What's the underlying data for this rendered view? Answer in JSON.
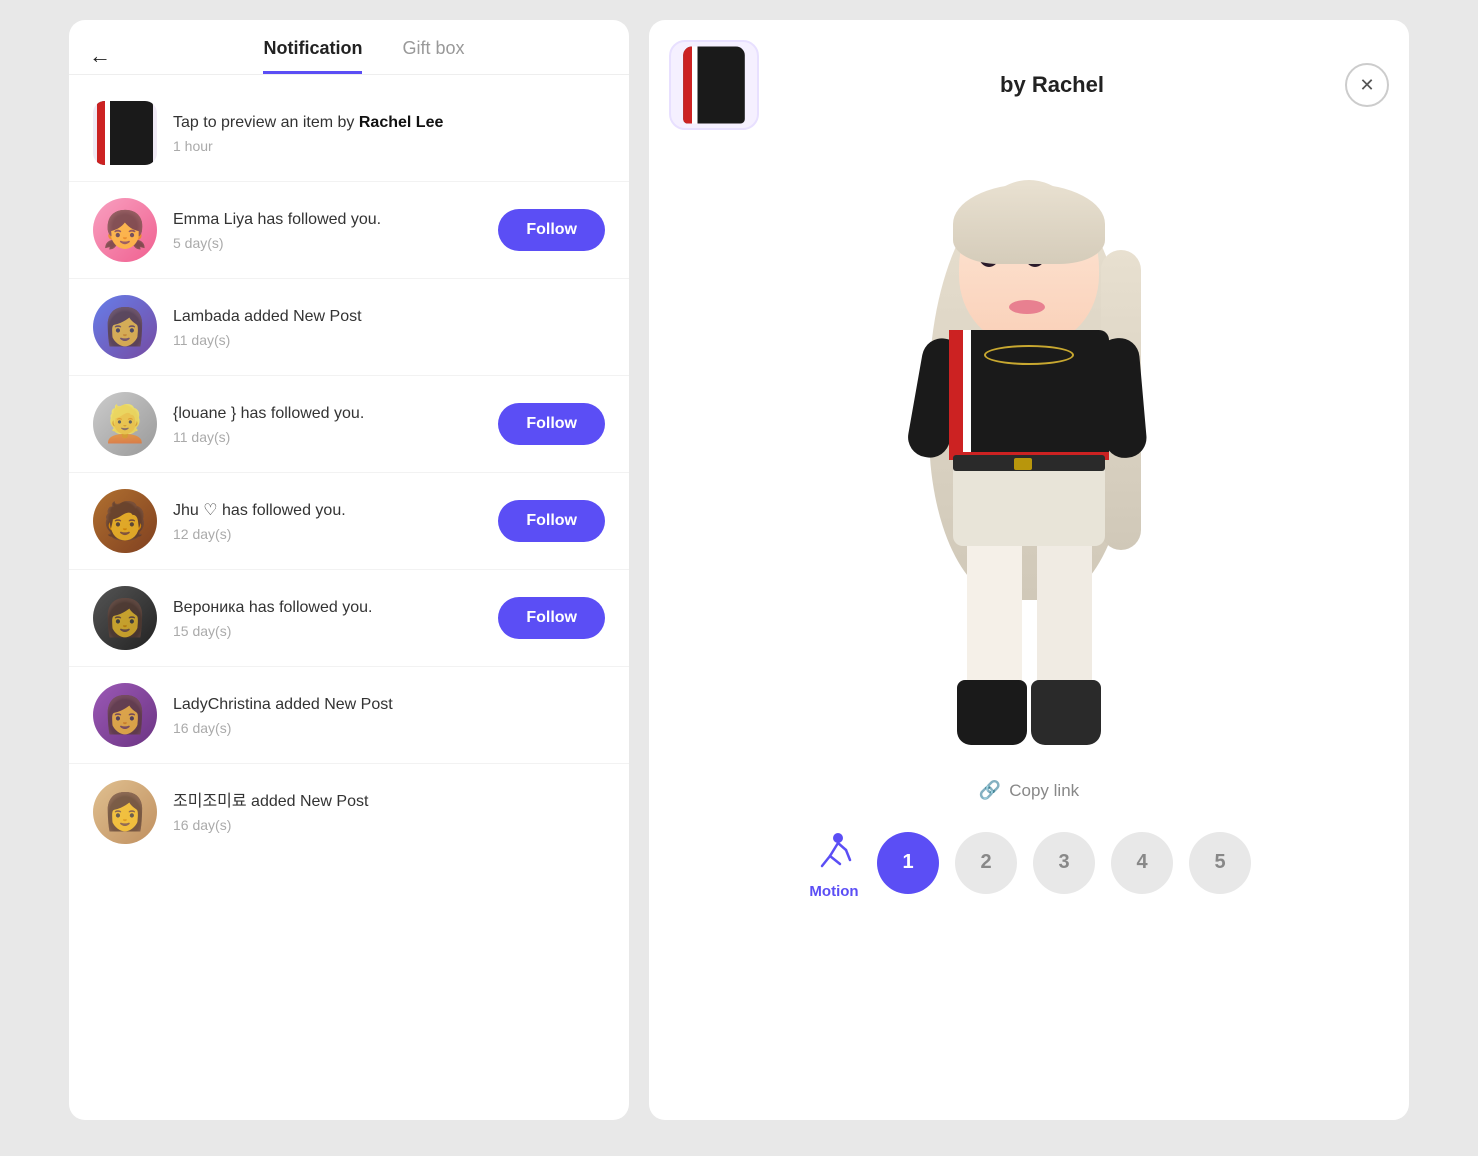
{
  "left": {
    "back_label": "←",
    "tabs": [
      {
        "id": "notification",
        "label": "Notification",
        "active": true
      },
      {
        "id": "giftbox",
        "label": "Gift box",
        "active": false
      }
    ],
    "notifications": [
      {
        "id": "notif-1",
        "type": "item",
        "avatar_type": "item",
        "message_prefix": "Tap to preview an item by ",
        "message_bold": "Rachel Lee",
        "time": "1 hour",
        "has_follow": false
      },
      {
        "id": "notif-2",
        "type": "follow",
        "avatar_type": "pink",
        "message": "Emma Liya has followed you.",
        "time": "5 day(s)",
        "has_follow": true,
        "follow_label": "Follow"
      },
      {
        "id": "notif-3",
        "type": "post",
        "avatar_type": "dark",
        "message": "Lambada added New Post",
        "time": "11 day(s)",
        "has_follow": false
      },
      {
        "id": "notif-4",
        "type": "follow",
        "avatar_type": "gray",
        "message": "{louane } has followed you.",
        "time": "11 day(s)",
        "has_follow": true,
        "follow_label": "Follow"
      },
      {
        "id": "notif-5",
        "type": "follow",
        "avatar_type": "glasses",
        "message": "Jhu ♡ has followed you.",
        "time": "12 day(s)",
        "has_follow": true,
        "follow_label": "Follow"
      },
      {
        "id": "notif-6",
        "type": "follow",
        "avatar_type": "dark2",
        "message": "Вероника has followed you.",
        "time": "15 day(s)",
        "has_follow": true,
        "follow_label": "Follow"
      },
      {
        "id": "notif-7",
        "type": "post",
        "avatar_type": "purple",
        "message": "LadyChristina added New Post",
        "time": "16 day(s)",
        "has_follow": false
      },
      {
        "id": "notif-8",
        "type": "post",
        "avatar_type": "korean",
        "message": "조미조미료 added New Post",
        "time": "16 day(s)",
        "has_follow": false
      }
    ]
  },
  "right": {
    "title": "by Rachel",
    "close_label": "✕",
    "copy_link_label": "Copy link",
    "motion_label": "Motion",
    "pages": [
      {
        "num": "1",
        "active": true
      },
      {
        "num": "2",
        "active": false
      },
      {
        "num": "3",
        "active": false
      },
      {
        "num": "4",
        "active": false
      },
      {
        "num": "5",
        "active": false
      }
    ]
  }
}
